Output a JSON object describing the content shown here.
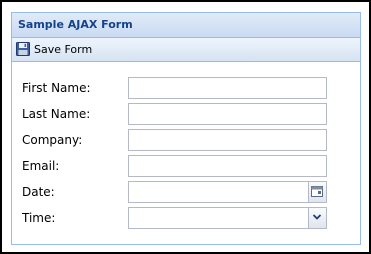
{
  "panel": {
    "title": "Sample AJAX Form"
  },
  "toolbar": {
    "save_label": "Save Form",
    "save_icon": "floppy-disk-icon"
  },
  "form": {
    "fields": [
      {
        "label": "First Name:",
        "value": "",
        "placeholder": ""
      },
      {
        "label": "Last Name:",
        "value": "",
        "placeholder": ""
      },
      {
        "label": "Company:",
        "value": "",
        "placeholder": ""
      },
      {
        "label": "Email:",
        "value": "",
        "placeholder": ""
      },
      {
        "label": "Date:",
        "value": "",
        "placeholder": "",
        "trigger_icon": "calendar-icon"
      },
      {
        "label": "Time:",
        "value": "",
        "placeholder": "",
        "trigger_icon": "chevron-down-icon"
      }
    ]
  },
  "colors": {
    "header_text": "#15428b",
    "panel_border": "#99bbe8",
    "field_border": "#b5b8c8"
  }
}
